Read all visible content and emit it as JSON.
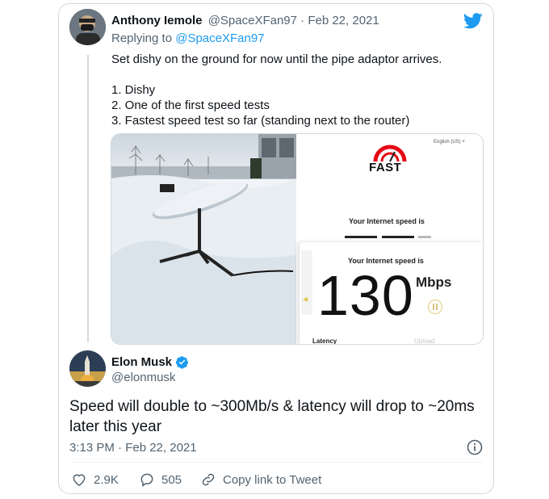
{
  "reply_tweet": {
    "author_name": "Anthony Iemole",
    "author_handle": "@SpaceXFan97",
    "separator": "·",
    "date": "Feb 22, 2021",
    "replying_prefix": "Replying to",
    "replying_handle": "@SpaceXFan97",
    "text": "Set dishy on the ground for now until the pipe adaptor arrives.\n\n1. Dishy\n2. One of the first speed tests\n3. Fastest speed test so far (standing next to the router)"
  },
  "speedtest": {
    "logo": "FAST",
    "language": "English (US) ˅",
    "label_top": "Your Internet speed is",
    "label_main": "Your Internet speed is",
    "speed": "130",
    "unit": "Mbps",
    "latency_label": "Latency",
    "upload_label": "Upload"
  },
  "main_tweet": {
    "author_name": "Elon Musk",
    "author_handle": "@elonmusk",
    "text": "Speed will double to ~300Mb/s & latency will drop to ~20ms later this year",
    "timestamp": "3:13 PM · Feb 22, 2021"
  },
  "actions": {
    "likes": "2.9K",
    "replies": "505",
    "copy_link": "Copy link to Tweet"
  },
  "colors": {
    "twitter_blue": "#1d9bf0",
    "fast_red": "#e50914",
    "verified": "#1d9bf0"
  },
  "icons": [
    "twitter-logo-icon",
    "fast-logo-icon",
    "verified-badge-icon",
    "info-icon",
    "heart-icon",
    "reply-icon",
    "link-icon",
    "pause-icon",
    "sound-icon"
  ]
}
